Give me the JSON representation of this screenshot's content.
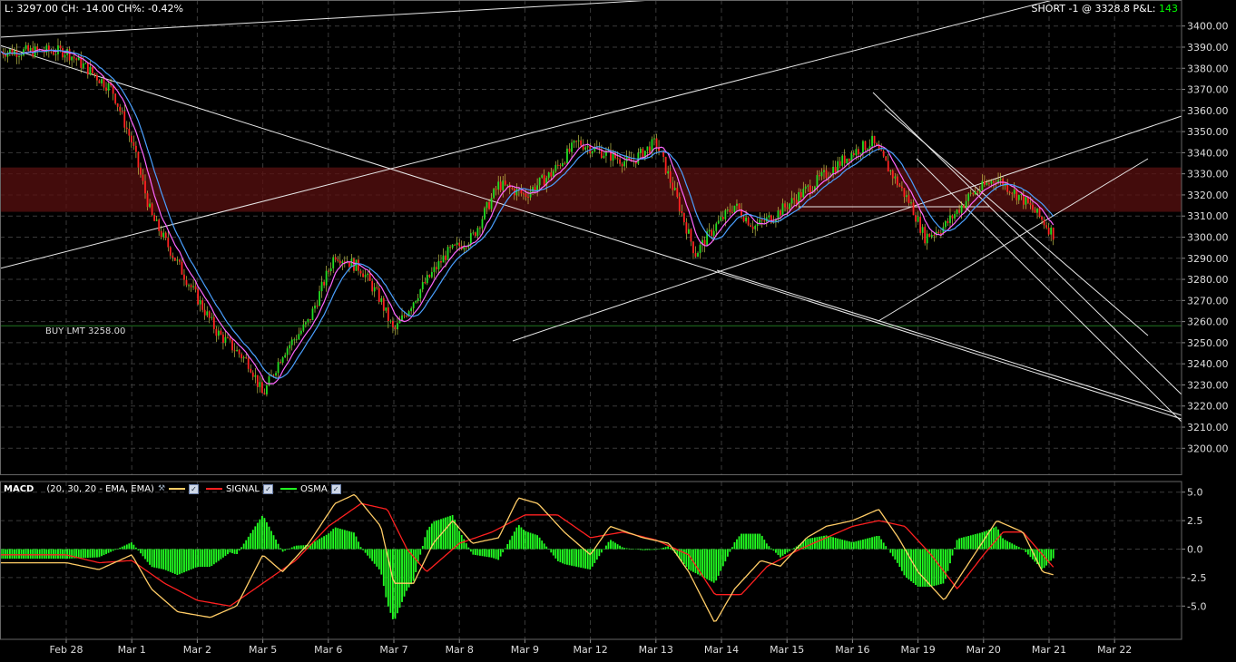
{
  "header": {
    "quote": "L: 3297.00 CH: -14.00 CH%: -0.42%",
    "position": "SHORT -1 @ 3328.8 P&L:",
    "pnl": "143"
  },
  "order_label": "BUY LMT 3258.00",
  "macd_legend": {
    "name": "MACD",
    "params": "(20, 30, 20 - EMA, EMA)",
    "signal": "SIGNAL",
    "osma": "OSMA"
  },
  "colors": {
    "background": "#000000",
    "grid": "#3a3a3a",
    "bull_candle": "#22dd22",
    "bear_candle": "#ff2222",
    "ma_fast": "#ff66ff",
    "ma_slow": "#4aa0ff",
    "macd_line": "#ffcc66",
    "signal_line": "#ff2020",
    "osma": "#22ff22",
    "resistance_zone": "#5a1010",
    "order_line": "#227722"
  },
  "chart_data": [
    {
      "type": "line",
      "x_categories": [
        "Feb 28",
        "Mar 1",
        "Mar 2",
        "Mar 5",
        "Mar 6",
        "Mar 7",
        "Mar 8",
        "Mar 9",
        "Mar 12",
        "Mar 13",
        "Mar 14",
        "Mar 15",
        "Mar 16",
        "Mar 19",
        "Mar 20",
        "Mar 21",
        "Mar 22"
      ],
      "y_ticks": [
        3200,
        3210,
        3220,
        3230,
        3240,
        3250,
        3260,
        3270,
        3280,
        3290,
        3300,
        3310,
        3320,
        3330,
        3340,
        3350,
        3360,
        3370,
        3380,
        3390,
        3400
      ],
      "ylim": [
        3190,
        3405
      ],
      "price_path": [
        [
          0,
          3388
        ],
        [
          0.7,
          3370
        ],
        [
          1,
          3345
        ],
        [
          1.3,
          3310
        ],
        [
          1.8,
          3282
        ],
        [
          2.3,
          3255
        ],
        [
          2.8,
          3240
        ],
        [
          3,
          3225
        ],
        [
          3.3,
          3245
        ],
        [
          3.7,
          3260
        ],
        [
          4.1,
          3292
        ],
        [
          4.5,
          3285
        ],
        [
          4.8,
          3270
        ],
        [
          5,
          3255
        ],
        [
          5.4,
          3275
        ],
        [
          5.8,
          3292
        ],
        [
          6.2,
          3300
        ],
        [
          6.6,
          3325
        ],
        [
          7,
          3320
        ],
        [
          7.4,
          3330
        ],
        [
          7.8,
          3345
        ],
        [
          8.2,
          3340
        ],
        [
          8.6,
          3335
        ],
        [
          9,
          3345
        ],
        [
          9.3,
          3320
        ],
        [
          9.6,
          3292
        ],
        [
          9.9,
          3305
        ],
        [
          10.2,
          3315
        ],
        [
          10.5,
          3305
        ],
        [
          10.8,
          3310
        ],
        [
          11.2,
          3320
        ],
        [
          11.6,
          3330
        ],
        [
          12,
          3340
        ],
        [
          12.3,
          3345
        ],
        [
          12.6,
          3330
        ],
        [
          12.9,
          3315
        ],
        [
          13.1,
          3300
        ],
        [
          13.4,
          3305
        ],
        [
          13.8,
          3320
        ],
        [
          14.2,
          3328
        ],
        [
          14.6,
          3318
        ],
        [
          14.9,
          3308
        ],
        [
          15.1,
          3300
        ]
      ],
      "resistance_zone": [
        3312,
        3333
      ],
      "order_level": 3258,
      "last": 3297.0,
      "change": -14.0,
      "change_pct": -0.42
    },
    {
      "type": "bar",
      "name": "MACD",
      "y_ticks": [
        5.0,
        2.5,
        0.0,
        -2.5,
        -5.0
      ],
      "ylim": [
        -7.5,
        5.5
      ],
      "macd_path": [
        [
          0,
          -1.2
        ],
        [
          0.5,
          -1.8
        ],
        [
          1,
          -0.5
        ],
        [
          1.3,
          -3.5
        ],
        [
          1.7,
          -5.5
        ],
        [
          2.2,
          -6
        ],
        [
          2.6,
          -5
        ],
        [
          3,
          -0.5
        ],
        [
          3.3,
          -2
        ],
        [
          3.7,
          0.5
        ],
        [
          4.1,
          4
        ],
        [
          4.4,
          4.8
        ],
        [
          4.8,
          2
        ],
        [
          5,
          -3
        ],
        [
          5.3,
          -3
        ],
        [
          5.6,
          0.5
        ],
        [
          5.9,
          2.5
        ],
        [
          6.2,
          0.5
        ],
        [
          6.6,
          1
        ],
        [
          6.9,
          4.5
        ],
        [
          7.2,
          4
        ],
        [
          7.6,
          1.5
        ],
        [
          8,
          -0.5
        ],
        [
          8.3,
          2
        ],
        [
          8.8,
          1
        ],
        [
          9.2,
          0.5
        ],
        [
          9.5,
          -2
        ],
        [
          9.9,
          -6.5
        ],
        [
          10.2,
          -3.5
        ],
        [
          10.6,
          -1
        ],
        [
          10.9,
          -1.5
        ],
        [
          11.3,
          1
        ],
        [
          11.6,
          2
        ],
        [
          12,
          2.5
        ],
        [
          12.4,
          3.5
        ],
        [
          12.7,
          1
        ],
        [
          13,
          -2
        ],
        [
          13.4,
          -4.5
        ],
        [
          13.8,
          -1
        ],
        [
          14.2,
          2.5
        ],
        [
          14.6,
          1.5
        ],
        [
          14.9,
          -2
        ],
        [
          15.1,
          -2.3
        ]
      ],
      "signal_path": [
        [
          0,
          -0.5
        ],
        [
          0.5,
          -1.2
        ],
        [
          1,
          -1
        ],
        [
          1.5,
          -3
        ],
        [
          2,
          -4.5
        ],
        [
          2.5,
          -5
        ],
        [
          3,
          -3
        ],
        [
          3.5,
          -1
        ],
        [
          4,
          2
        ],
        [
          4.5,
          4
        ],
        [
          4.9,
          3.5
        ],
        [
          5.2,
          0
        ],
        [
          5.5,
          -2
        ],
        [
          6,
          0.5
        ],
        [
          6.5,
          1.5
        ],
        [
          7,
          3
        ],
        [
          7.5,
          3
        ],
        [
          8,
          1
        ],
        [
          8.5,
          1.5
        ],
        [
          9,
          0.8
        ],
        [
          9.5,
          -0.5
        ],
        [
          9.9,
          -4
        ],
        [
          10.3,
          -4
        ],
        [
          10.7,
          -1.5
        ],
        [
          11.2,
          0
        ],
        [
          11.6,
          1
        ],
        [
          12,
          2
        ],
        [
          12.4,
          2.5
        ],
        [
          12.8,
          2
        ],
        [
          13.2,
          -0.5
        ],
        [
          13.6,
          -3.5
        ],
        [
          14,
          -0.5
        ],
        [
          14.3,
          1.5
        ],
        [
          14.6,
          1.5
        ],
        [
          14.9,
          -0.5
        ],
        [
          15.1,
          -1.8
        ]
      ]
    }
  ]
}
